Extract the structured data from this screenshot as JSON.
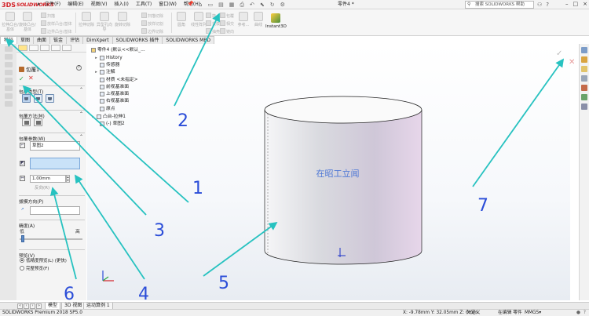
{
  "titlebar": {
    "logo_mark": "3DS",
    "logo_text": "SOLIDWORKS",
    "menu": [
      "文件(F)",
      "编辑(E)",
      "视图(V)",
      "插入(I)",
      "工具(T)",
      "窗口(W)",
      "帮助(H)"
    ],
    "document_title": "零件4 *",
    "help_search_placeholder": "搜索 SOLIDWORKS 帮助",
    "window_controls": [
      "–",
      "□",
      "×"
    ]
  },
  "ribbon": {
    "big_buttons": [
      {
        "icon": "extrude-boss-icon",
        "label": "拉伸凸台/基体"
      },
      {
        "icon": "revolve-boss-icon",
        "label": "旋转凸台/基体"
      },
      {
        "icon": "extrude-cut-icon",
        "label": "拉伸切除"
      },
      {
        "icon": "hole-wizard-icon",
        "label": "异型孔向导"
      },
      {
        "icon": "revolve-cut-icon",
        "label": "旋转切除"
      },
      {
        "icon": "fillet-icon",
        "label": "圆角"
      },
      {
        "icon": "linear-pattern-icon",
        "label": "线性阵列"
      },
      {
        "icon": "rib-icon",
        "label": "筋"
      },
      {
        "icon": "wrap-icon",
        "label": "包覆"
      },
      {
        "icon": "reference-geometry-icon",
        "label": "参考..."
      },
      {
        "icon": "curves-icon",
        "label": "曲线"
      }
    ],
    "small_buttons": [
      "扫描",
      "放样凸台/基体",
      "边界凸台/基体",
      "扫描切除",
      "放样切割",
      "边界切除",
      "拔模",
      "抽壳",
      "相交",
      "镜向"
    ],
    "instant3d_label": "Instant3D"
  },
  "tabs": [
    "特征",
    "草图",
    "曲面",
    "钣金",
    "评估",
    "DimXpert",
    "SOLIDWORKS 插件",
    "SOLIDWORKS MBD"
  ],
  "property_manager": {
    "title": "包覆1",
    "help_icon": "?",
    "ok": "✓",
    "cancel": "✕",
    "sections": {
      "wrap_type": "包覆类型(T)",
      "wrap_method": "包覆方法(M)",
      "wrap_params": "包覆参数(W)",
      "pull_direction": "拔模方向(P)",
      "accuracy": "精度(A)",
      "preview": "预览(V)"
    },
    "sketch_value": "草图2",
    "thickness_value": "1.00mm",
    "reverse_label": "反向(R)",
    "accuracy_low": "低",
    "accuracy_high": "高",
    "preview_fast": "低精度预览(L) (更快)",
    "preview_full": "完整预览(F)",
    "accuracy_level": 0.02
  },
  "feature_tree": {
    "root": "零件4 (默认<<默认_...",
    "items": [
      {
        "label": "History",
        "expander": "▸"
      },
      {
        "label": "传感器",
        "expander": ""
      },
      {
        "label": "注解",
        "expander": "▸"
      },
      {
        "label": "材质 <未指定>",
        "expander": ""
      },
      {
        "label": "前视基准面",
        "expander": ""
      },
      {
        "label": "上视基准面",
        "expander": ""
      },
      {
        "label": "右视基准面",
        "expander": ""
      },
      {
        "label": "原点",
        "expander": ""
      },
      {
        "label": "凸台-拉伸1",
        "expander": "▸"
      },
      {
        "label": "(-) 草图2",
        "expander": ""
      }
    ]
  },
  "viewport": {
    "wrap_text": "在昭工立闻",
    "annotations": [
      "1",
      "2",
      "3",
      "4",
      "5",
      "6",
      "7"
    ],
    "confirm_ok": "✓",
    "confirm_cancel": "✕"
  },
  "bottom_tabs": [
    "模型",
    "3D 视图",
    "运动算例 1"
  ],
  "status": {
    "product": "SOLIDWORKS Premium 2018 SP5.0",
    "coords": "X: -9.78mm Y: 32.05mm Z: 0mm",
    "state": "欠定义",
    "mode": "在编辑 零件",
    "units": "MMGS",
    "units_arrow": "▾"
  },
  "colors": {
    "brand_red": "#d32026",
    "annotation": "#2b4dd8",
    "arrow": "#27c2c0",
    "cylinder_tint": "#e7d6ea"
  }
}
